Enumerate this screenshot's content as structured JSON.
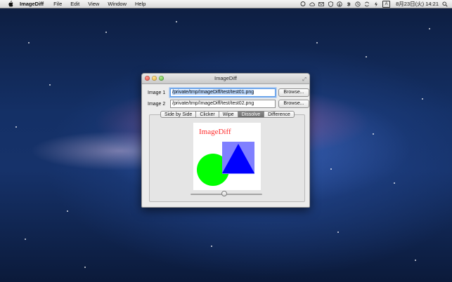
{
  "menubar": {
    "app_name": "ImageDiff",
    "menus": [
      "File",
      "Edit",
      "View",
      "Window",
      "Help"
    ],
    "status_icons": [
      "display-icon",
      "cloud-icon",
      "mail-icon",
      "shield-icon",
      "download-icon",
      "bluetooth-icon",
      "time-machine-icon",
      "sync-icon",
      "battery-icon",
      "input-method-icon"
    ],
    "input_indicator": "A",
    "clock": "8月23日(火)  14:21"
  },
  "window": {
    "title": "ImageDiff",
    "image1": {
      "label": "Image 1",
      "path": "/private/tmp/ImageDiff/test/test01.png",
      "browse_label": "Browse..."
    },
    "image2": {
      "label": "Image 2",
      "path": "/private/tmp/ImageDiff/test/test02.png",
      "browse_label": "Browse..."
    },
    "tabs": [
      {
        "label": "Side by Side",
        "active": false
      },
      {
        "label": "Clicker",
        "active": false
      },
      {
        "label": "Wipe",
        "active": false
      },
      {
        "label": "Dissolve",
        "active": true
      },
      {
        "label": "Difference",
        "active": false
      }
    ],
    "preview": {
      "text": "ImageDiff",
      "text_color": "#ff2a2a",
      "circle_color": "#00ff00",
      "square_color": "#8080ff",
      "triangle_color": "#0000ff"
    },
    "dissolve_slider": {
      "value": 0.47
    }
  }
}
